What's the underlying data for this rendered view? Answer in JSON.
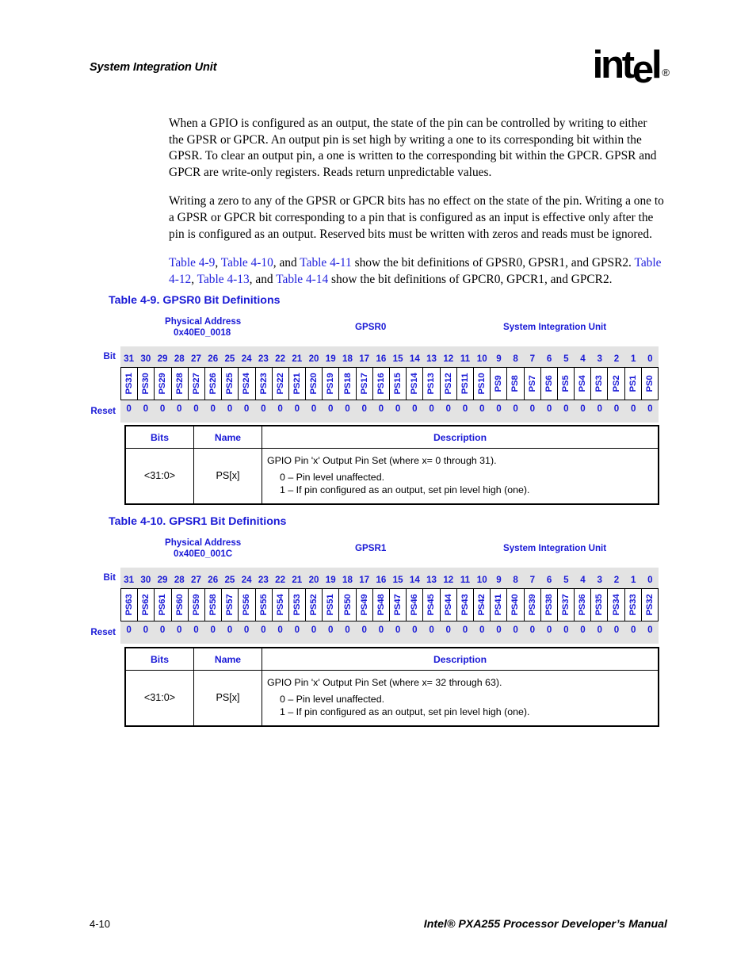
{
  "header": {
    "running_title": "System Integration Unit",
    "logo_text": "intel",
    "logo_registered": "®"
  },
  "body": {
    "paragraph_1": "When a GPIO is configured as an output, the state of the pin can be controlled by writing to either the GPSR or GPCR. An output pin is set high by writing a one to its corresponding bit within the GPSR. To clear an output pin, a one is written to the corresponding bit within the GPCR. GPSR and GPCR are write-only registers. Reads return unpredictable values.",
    "paragraph_2": "Writing a zero to any of the GPSR or GPCR bits has no effect on the state of the pin. Writing a one to a GPSR or GPCR bit corresponding to a pin that is configured as an input is effective only after the pin is configured as an output. Reserved bits must be written with zeros and reads must be ignored.",
    "xref_line_1": {
      "link_1": "Table 4-9",
      "sep_1": ", ",
      "link_2": "Table 4-10",
      "sep_2": ", and ",
      "link_3": "Table 4-11",
      "tail": " show the bit definitions of GPSR0, GPSR1, and GPSR2."
    },
    "xref_line_2": {
      "link_1": "Table 4-12",
      "sep_1": ", ",
      "link_2": "Table 4-13",
      "sep_2": ", and ",
      "link_3": "Table 4-14",
      "tail": " show the bit definitions of GPCR0, GPCR1, and GPCR2."
    }
  },
  "colors": {
    "link_blue": "#2222dd",
    "heading_blue": "#1a1ad6",
    "grid_gray": "#e3e3e3",
    "text_black": "#000000"
  },
  "table_9": {
    "caption": "Table 4-9. GPSR0 Bit Definitions",
    "physical_address_label": "Physical Address",
    "physical_address_value": "0x40E0_0018",
    "register_name": "GPSR0",
    "unit_name": "System Integration Unit",
    "bit_row_label": "Bit",
    "reset_row_label": "Reset",
    "bit_numbers": [
      "31",
      "30",
      "29",
      "28",
      "27",
      "26",
      "25",
      "24",
      "23",
      "22",
      "21",
      "20",
      "19",
      "18",
      "17",
      "16",
      "15",
      "14",
      "13",
      "12",
      "11",
      "10",
      "9",
      "8",
      "7",
      "6",
      "5",
      "4",
      "3",
      "2",
      "1",
      "0"
    ],
    "field_names": [
      "PS31",
      "PS30",
      "PS29",
      "PS28",
      "PS27",
      "PS26",
      "PS25",
      "PS24",
      "PS23",
      "PS22",
      "PS21",
      "PS20",
      "PS19",
      "PS18",
      "PS17",
      "PS16",
      "PS15",
      "PS14",
      "PS13",
      "PS12",
      "PS11",
      "PS10",
      "PS9",
      "PS8",
      "PS7",
      "PS6",
      "PS5",
      "PS4",
      "PS3",
      "PS2",
      "PS1",
      "PS0"
    ],
    "reset_values": [
      "0",
      "0",
      "0",
      "0",
      "0",
      "0",
      "0",
      "0",
      "0",
      "0",
      "0",
      "0",
      "0",
      "0",
      "0",
      "0",
      "0",
      "0",
      "0",
      "0",
      "0",
      "0",
      "0",
      "0",
      "0",
      "0",
      "0",
      "0",
      "0",
      "0",
      "0",
      "0"
    ],
    "columns": [
      "Bits",
      "Name",
      "Description"
    ],
    "rows": [
      {
        "bits": "<31:0>",
        "name": "PS[x]",
        "desc_first": "GPIO Pin 'x' Output Pin Set (where x= 0 through 31).",
        "desc_line_0": "0 –  Pin level unaffected.",
        "desc_line_1": "1 –  If pin configured as an output, set pin level high (one)."
      }
    ]
  },
  "table_10": {
    "caption": "Table 4-10. GPSR1 Bit Definitions",
    "physical_address_label": "Physical Address",
    "physical_address_value": "0x40E0_001C",
    "register_name": "GPSR1",
    "unit_name": "System Integration Unit",
    "bit_row_label": "Bit",
    "reset_row_label": "Reset",
    "bit_numbers": [
      "31",
      "30",
      "29",
      "28",
      "27",
      "26",
      "25",
      "24",
      "23",
      "22",
      "21",
      "20",
      "19",
      "18",
      "17",
      "16",
      "15",
      "14",
      "13",
      "12",
      "11",
      "10",
      "9",
      "8",
      "7",
      "6",
      "5",
      "4",
      "3",
      "2",
      "1",
      "0"
    ],
    "field_names": [
      "PS63",
      "PS62",
      "PS61",
      "PS60",
      "PS59",
      "PS58",
      "PS57",
      "PS56",
      "PS55",
      "PS54",
      "PS53",
      "PS52",
      "PS51",
      "PS50",
      "PS49",
      "PS48",
      "PS47",
      "PS46",
      "PS45",
      "PS44",
      "PS43",
      "PS42",
      "PS41",
      "PS40",
      "PS39",
      "PS38",
      "PS37",
      "PS36",
      "PS35",
      "PS34",
      "PS33",
      "PS32"
    ],
    "reset_values": [
      "0",
      "0",
      "0",
      "0",
      "0",
      "0",
      "0",
      "0",
      "0",
      "0",
      "0",
      "0",
      "0",
      "0",
      "0",
      "0",
      "0",
      "0",
      "0",
      "0",
      "0",
      "0",
      "0",
      "0",
      "0",
      "0",
      "0",
      "0",
      "0",
      "0",
      "0",
      "0"
    ],
    "columns": [
      "Bits",
      "Name",
      "Description"
    ],
    "rows": [
      {
        "bits": "<31:0>",
        "name": "PS[x]",
        "desc_first": "GPIO Pin 'x' Output Pin Set (where x= 32 through 63).",
        "desc_line_0": "0 –  Pin level unaffected.",
        "desc_line_1": "1 –  If pin configured as an output, set pin level high (one)."
      }
    ]
  },
  "footer": {
    "page_number": "4-10",
    "manual_title": "Intel® PXA255 Processor Developer’s Manual"
  }
}
